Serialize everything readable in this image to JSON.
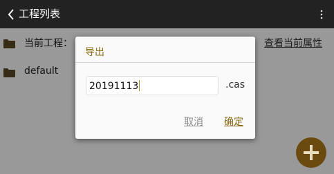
{
  "app_bar": {
    "title": "工程列表",
    "back_icon": "chevron-left-icon",
    "menu_icon": "more-vertical-icon"
  },
  "list": {
    "current_project_label": "当前工程：",
    "view_properties_link": "查看当前属性",
    "items": [
      {
        "name": "default",
        "icon": "folder-icon"
      }
    ]
  },
  "dialog": {
    "title": "导出",
    "filename_value": "20191113",
    "extension": ".cas",
    "cancel_label": "取消",
    "ok_label": "确定"
  },
  "fab": {
    "icon": "plus-icon"
  },
  "colors": {
    "app_bar_bg": "#222222",
    "accent": "#8a6b14",
    "folder": "#5a4a24",
    "fab_bg": "#6b4a0f"
  }
}
